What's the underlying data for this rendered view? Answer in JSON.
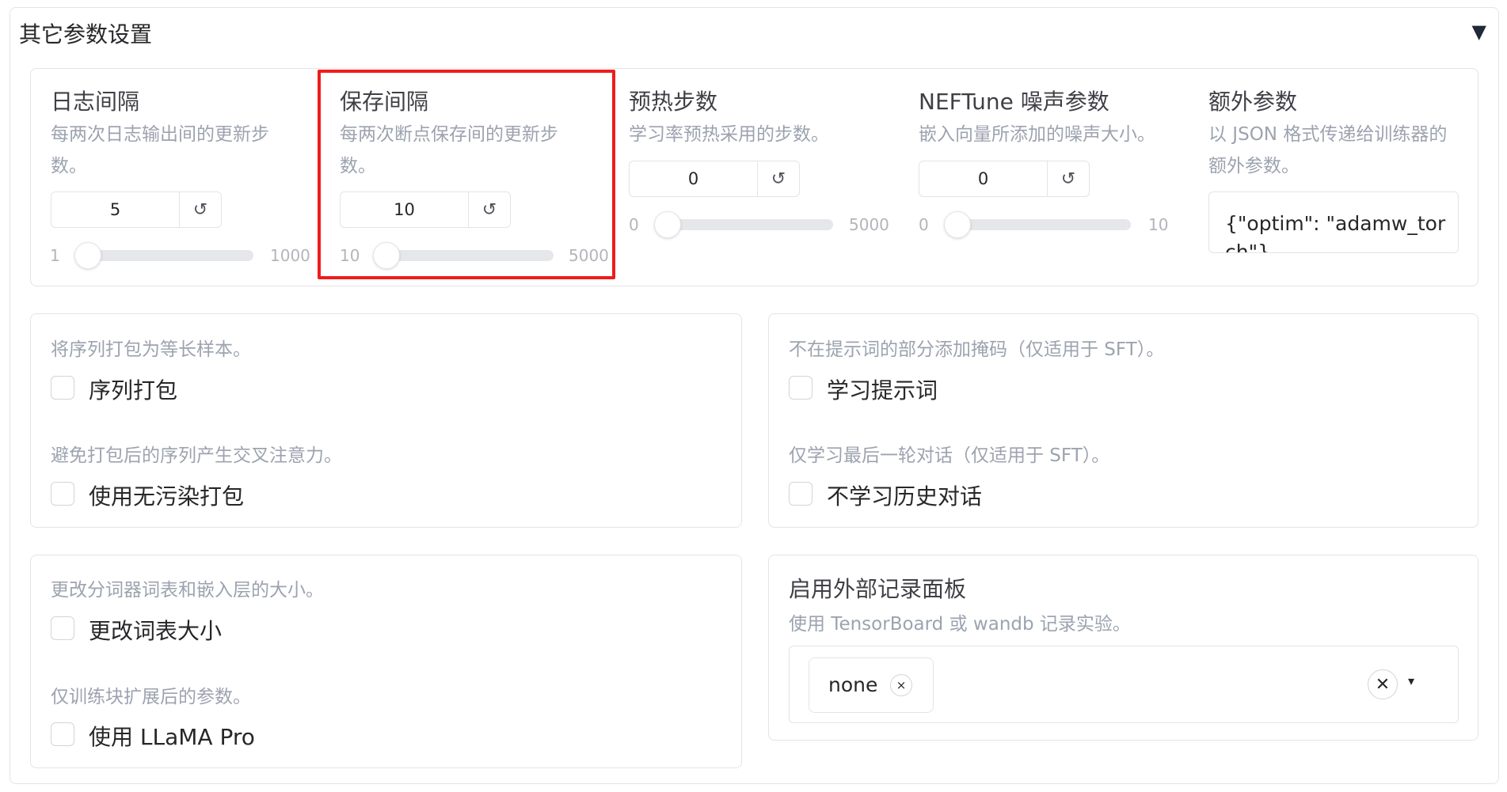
{
  "accordion": {
    "title": "其它参数设置",
    "toggle_icon": "▼"
  },
  "params": [
    {
      "label": "日志间隔",
      "info": "每两次日志输出间的更新步数。",
      "value": "5",
      "min": "1",
      "max": "1000",
      "reset_icon": "↺",
      "slider_fraction": 0.004
    },
    {
      "label": "保存间隔",
      "info": "每两次断点保存间的更新步数。",
      "value": "10",
      "min": "10",
      "max": "5000",
      "reset_icon": "↺",
      "slider_fraction": 0.0
    },
    {
      "label": "预热步数",
      "info": "学习率预热采用的步数。",
      "value": "0",
      "min": "0",
      "max": "5000",
      "reset_icon": "↺",
      "slider_fraction": 0.0
    },
    {
      "label": "NEFTune 噪声参数",
      "info": "嵌入向量所添加的噪声大小。",
      "value": "0",
      "min": "0",
      "max": "10",
      "reset_icon": "↺",
      "slider_fraction": 0.0
    },
    {
      "label": "额外参数",
      "info": "以 JSON 格式传递给训练器的额外参数。",
      "value": "{\"optim\": \"adamw_torch\"}"
    }
  ],
  "checkboxes": [
    {
      "info": "将序列打包为等长样本。",
      "label": "序列打包",
      "checked": false
    },
    {
      "info": "避免打包后的序列产生交叉注意力。",
      "label": "使用无污染打包",
      "checked": false
    },
    {
      "info": "不在提示词的部分添加掩码（仅适用于 SFT）。",
      "label": "学习提示词",
      "checked": false
    },
    {
      "info": "仅学习最后一轮对话（仅适用于 SFT）。",
      "label": "不学习历史对话",
      "checked": false
    },
    {
      "info": "更改分词器词表和嵌入层的大小。",
      "label": "更改词表大小",
      "checked": false
    },
    {
      "info": "仅训练块扩展后的参数。",
      "label": "使用 LLaMA Pro",
      "checked": false
    }
  ],
  "report_to": {
    "label": "启用外部记录面板",
    "info": "使用 TensorBoard 或 wandb 记录实验。",
    "selected": [
      "none"
    ],
    "token_remove_icon": "×",
    "clear_icon": "✕",
    "caret_icon": "▾"
  }
}
